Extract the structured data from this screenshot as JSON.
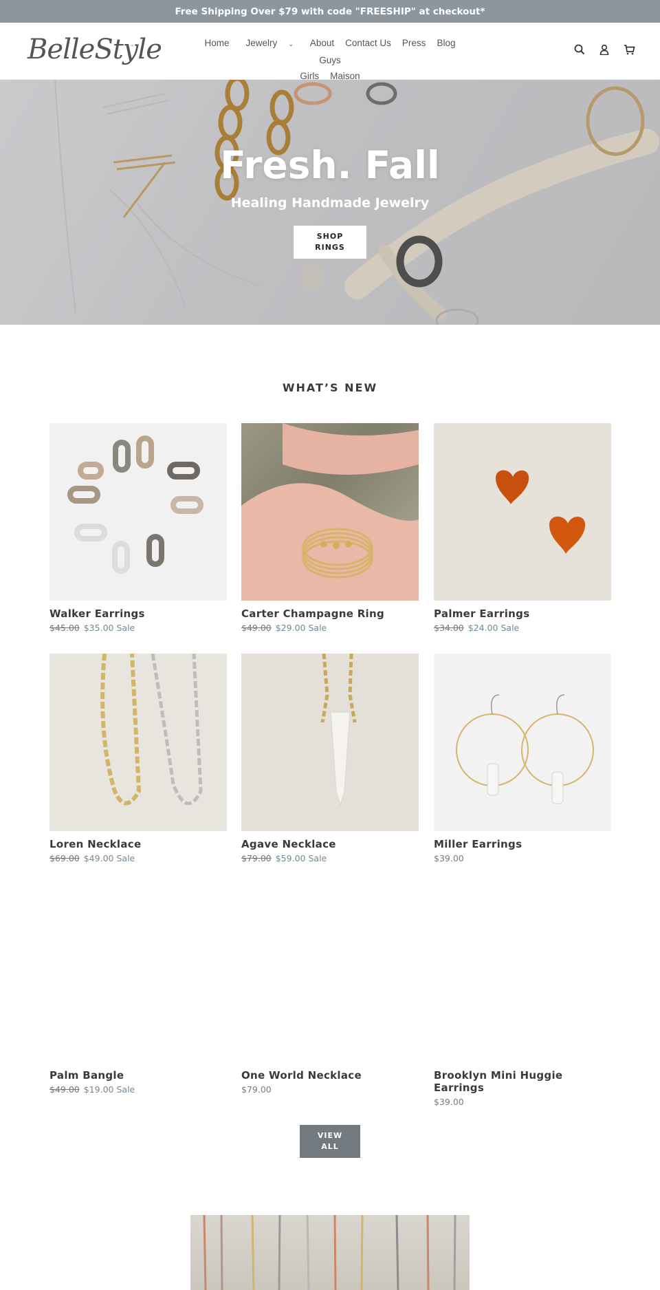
{
  "announcement": "Free Shipping Over $79 with code \"FREESHIP\" at checkout*",
  "brand": {
    "logo_text": "BelleStyle",
    "logo_mark": "™"
  },
  "nav": {
    "items": [
      {
        "label": "Home"
      },
      {
        "label": "Jewelry",
        "has_dropdown": true
      },
      {
        "label": "About"
      },
      {
        "label": "Contact Us"
      },
      {
        "label": "Press"
      },
      {
        "label": "Blog"
      },
      {
        "label": "Guys"
      },
      {
        "label": "Girls"
      },
      {
        "label": "Maison"
      }
    ],
    "icons": [
      "search-icon",
      "account-icon",
      "cart-icon"
    ]
  },
  "hero": {
    "title": "Fresh. Fall",
    "subtitle": "Healing Handmade Jewelry",
    "button_line1": "SHOP",
    "button_line2": "RINGS"
  },
  "section": {
    "title": "WHAT’S NEW"
  },
  "products": [
    {
      "name": "Walker Earrings",
      "old_price": "$45.00",
      "price": "$35.00",
      "sale_label": "Sale"
    },
    {
      "name": "Carter Champagne Ring",
      "old_price": "$49.00",
      "price": "$29.00",
      "sale_label": "Sale"
    },
    {
      "name": "Palmer Earrings",
      "old_price": "$34.00",
      "price": "$24.00",
      "sale_label": "Sale"
    },
    {
      "name": "Loren Necklace",
      "old_price": "$69.00",
      "price": "$49.00",
      "sale_label": "Sale"
    },
    {
      "name": "Agave Necklace",
      "old_price": "$79.00",
      "price": "$59.00",
      "sale_label": "Sale"
    },
    {
      "name": "Miller Earrings",
      "old_price": "",
      "price": "$39.00",
      "sale_label": ""
    },
    {
      "name": "Palm Bangle",
      "old_price": "$49.00",
      "price": "$19.00",
      "sale_label": "Sale"
    },
    {
      "name": "One World Necklace",
      "old_price": "",
      "price": "$79.00",
      "sale_label": ""
    },
    {
      "name": "Brooklyn Mini Huggie Earrings",
      "old_price": "",
      "price": "$39.00",
      "sale_label": ""
    }
  ],
  "view_all": {
    "line1": "VIEW",
    "line2": "ALL"
  },
  "colors": {
    "announcement_bg": "#8d959d",
    "sale_text": "#6f8a96",
    "button_dark": "#727a80"
  }
}
